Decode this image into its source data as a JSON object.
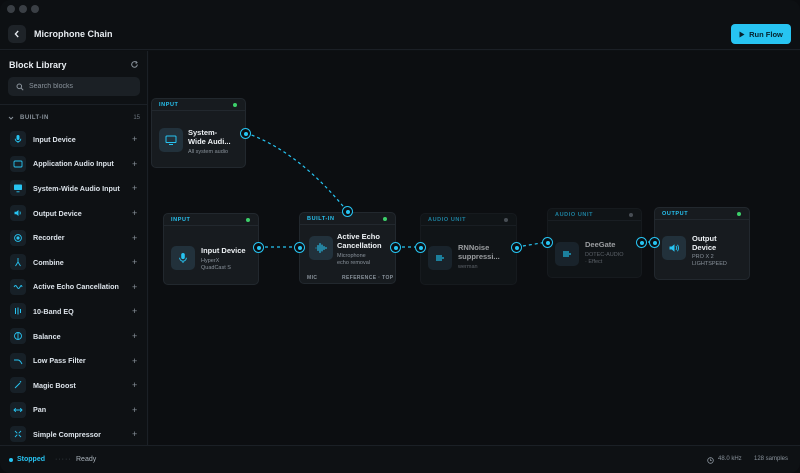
{
  "header": {
    "title": "Microphone Chain",
    "run_label": "Run Flow"
  },
  "sidebar": {
    "title": "Block Library",
    "search_placeholder": "Search blocks",
    "section_label": "BUILT-IN",
    "section_count": "15",
    "items": [
      {
        "label": "Input Device",
        "icon": "microphone-icon"
      },
      {
        "label": "Application Audio Input",
        "icon": "window-icon"
      },
      {
        "label": "System-Wide Audio Input",
        "icon": "monitor-icon"
      },
      {
        "label": "Output Device",
        "icon": "speaker-icon"
      },
      {
        "label": "Recorder",
        "icon": "record-icon"
      },
      {
        "label": "Combine",
        "icon": "merge-icon"
      },
      {
        "label": "Active Echo Cancellation",
        "icon": "echo-icon"
      },
      {
        "label": "10-Band EQ",
        "icon": "equalizer-icon"
      },
      {
        "label": "Balance",
        "icon": "balance-icon"
      },
      {
        "label": "Low Pass Filter",
        "icon": "filter-icon"
      },
      {
        "label": "Magic Boost",
        "icon": "wand-icon"
      },
      {
        "label": "Pan",
        "icon": "pan-icon"
      },
      {
        "label": "Simple Compressor",
        "icon": "compress-icon"
      }
    ]
  },
  "nodes": {
    "system_input": {
      "type": "INPUT",
      "name_line1": "System-",
      "name_line2": "Wide Audi...",
      "sub": "All system audio"
    },
    "input_device": {
      "type": "INPUT",
      "name": "Input Device",
      "sub_line1": "HyperX",
      "sub_line2": "QuadCast S"
    },
    "echo": {
      "type": "BUILT-IN",
      "name_line1": "Active Echo",
      "name_line2": "Cancellation",
      "sub_line1": "Microphone",
      "sub_line2": "echo removal",
      "foot_left": "MIC",
      "foot_right": "REFERENCE · TOP"
    },
    "rnnoise": {
      "type": "AUDIO UNIT",
      "name_line1": "RNNoise",
      "name_line2": "suppressi...",
      "sub": "werman"
    },
    "deegate": {
      "type": "AUDIO UNIT",
      "name": "DeeGate",
      "sub_line1": "DOTEC-AUDIO",
      "sub_line2": "· Effect"
    },
    "output": {
      "type": "OUTPUT",
      "name_line1": "Output",
      "name_line2": "Device",
      "sub_line1": "PRO X 2",
      "sub_line2": "LIGHTSPEED"
    }
  },
  "status": {
    "state": "Stopped",
    "separator": "·····",
    "message": "Ready",
    "sample_rate": "48.0 kHz",
    "buffer": "128 samples"
  },
  "colors": {
    "accent": "#27c4f2",
    "active": "#3ccf6a",
    "background": "#0c0e11"
  }
}
